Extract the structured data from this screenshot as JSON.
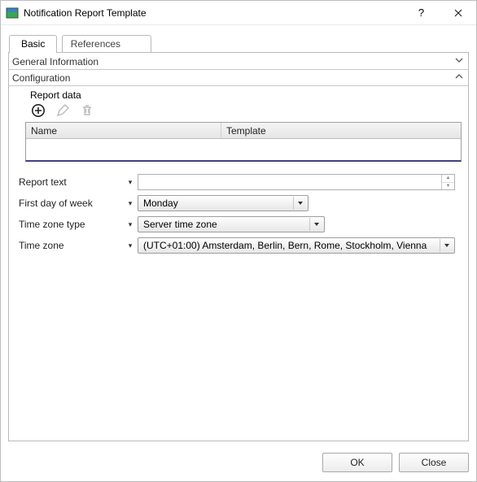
{
  "window": {
    "title": "Notification Report Template"
  },
  "tabs": {
    "basic": "Basic",
    "references": "References"
  },
  "sections": {
    "general": {
      "title": "General Information"
    },
    "config": {
      "title": "Configuration",
      "report_data_label": "Report data",
      "grid": {
        "col_name": "Name",
        "col_template": "Template"
      }
    }
  },
  "fields": {
    "report_text": {
      "label": "Report text",
      "value": ""
    },
    "first_day": {
      "label": "First day of week",
      "value": "Monday"
    },
    "tz_type": {
      "label": "Time zone type",
      "value": "Server time zone"
    },
    "tz": {
      "label": "Time zone",
      "value": "(UTC+01:00) Amsterdam, Berlin, Bern, Rome, Stockholm, Vienna"
    }
  },
  "buttons": {
    "ok": "OK",
    "close": "Close"
  }
}
